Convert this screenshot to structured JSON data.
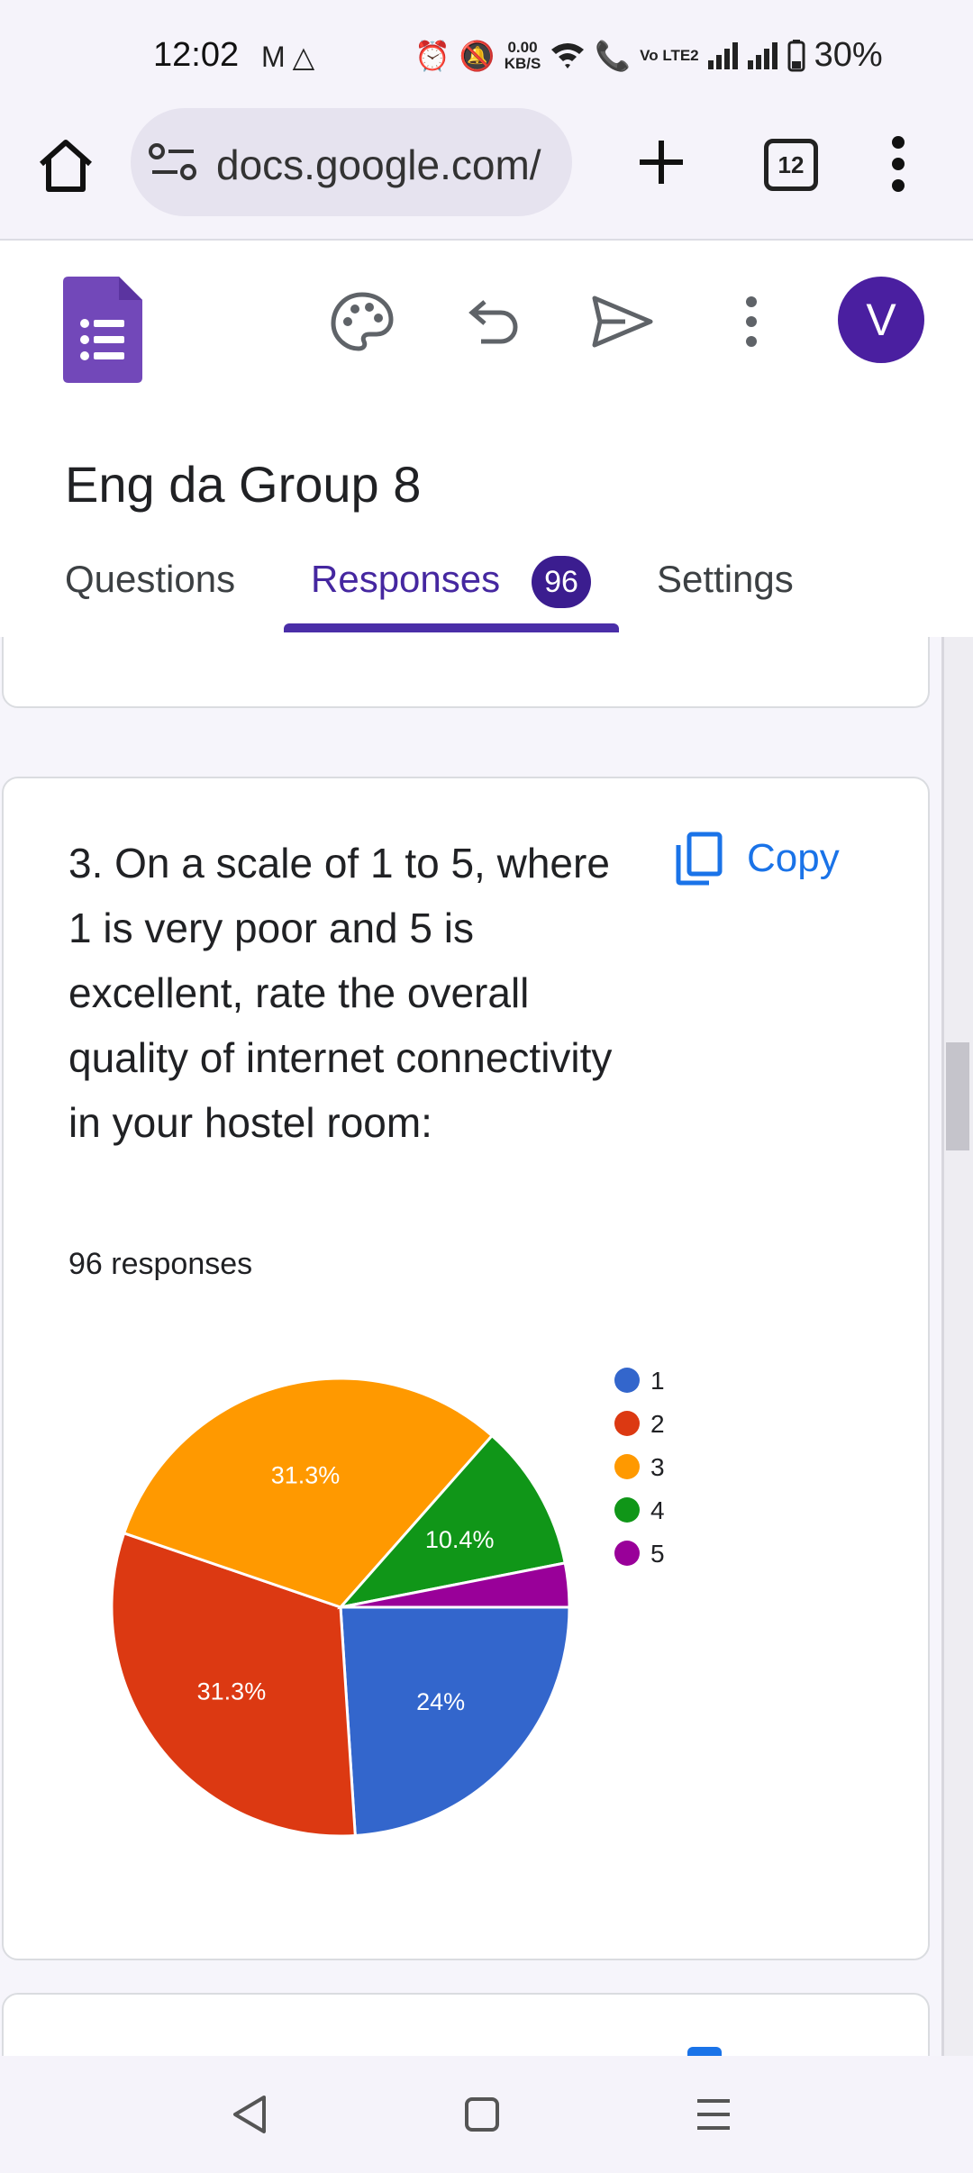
{
  "status_bar": {
    "time": "12:02",
    "left_icons": [
      "gmail-icon",
      "drive-icon"
    ],
    "net_speed_value": "0.00",
    "net_speed_unit": "KB/S",
    "volte_label": "Vo LTE2",
    "battery": "30%"
  },
  "browser": {
    "url": "docs.google.com/",
    "tab_count": "12"
  },
  "form": {
    "title": "Eng da Group 8",
    "tabs": [
      {
        "label": "Questions"
      },
      {
        "label": "Responses",
        "badge": "96"
      },
      {
        "label": "Settings"
      }
    ],
    "avatar_initial": "V"
  },
  "question": {
    "text": "3. On a scale of 1 to 5, where 1 is very poor and 5 is excellent, rate the overall quality of internet connectivity in your hostel room:",
    "copy_label": "Copy",
    "responses": "96 responses"
  },
  "chart_data": {
    "type": "pie",
    "categories": [
      "1",
      "2",
      "3",
      "4",
      "5"
    ],
    "values": [
      24,
      31.3,
      31.3,
      10.4,
      3.1
    ],
    "slice_labels": [
      "24%",
      "31.3%",
      "31.3%",
      "10.4%",
      ""
    ],
    "colors": [
      "#3366cc",
      "#dc3912",
      "#ff9900",
      "#109618",
      "#990099"
    ],
    "legend_position": "right"
  },
  "colors": {
    "accent": "#4a2ea8",
    "forms_purple": "#7248b9",
    "link_blue": "#1a73e8"
  }
}
